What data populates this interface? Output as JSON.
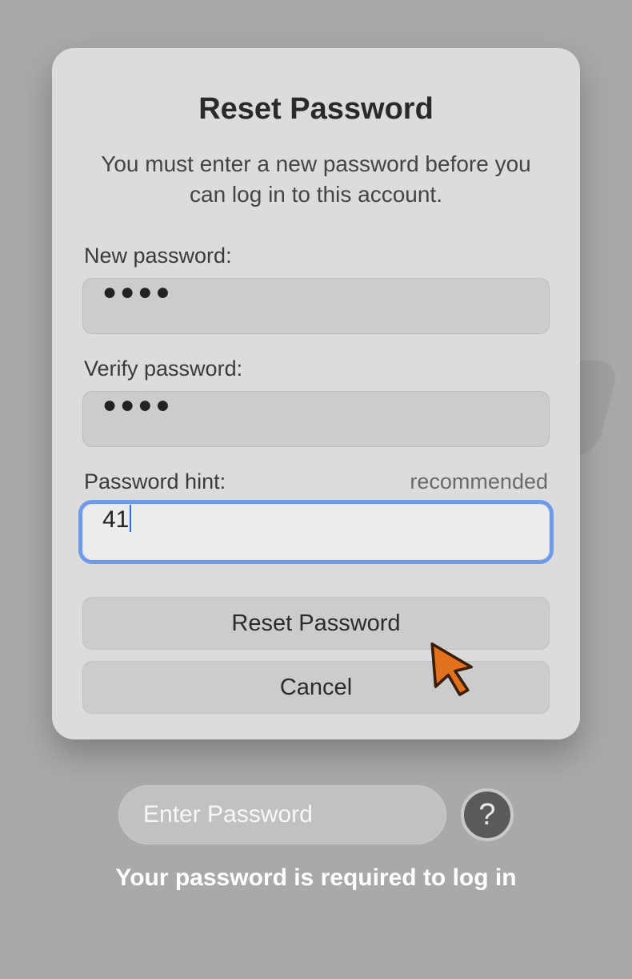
{
  "dialog": {
    "title": "Reset Password",
    "subtitle": "You must enter a new password before you can log in to this account.",
    "fields": {
      "new_password": {
        "label": "New password:",
        "value_masked": "●●●●"
      },
      "verify_password": {
        "label": "Verify password:",
        "value_masked": "●●●●"
      },
      "hint": {
        "label": "Password hint:",
        "aux": "recommended",
        "value": "41"
      }
    },
    "buttons": {
      "reset": "Reset Password",
      "cancel": "Cancel"
    }
  },
  "login": {
    "placeholder": "Enter Password",
    "help_glyph": "?",
    "caption": "Your password is required to log in"
  }
}
